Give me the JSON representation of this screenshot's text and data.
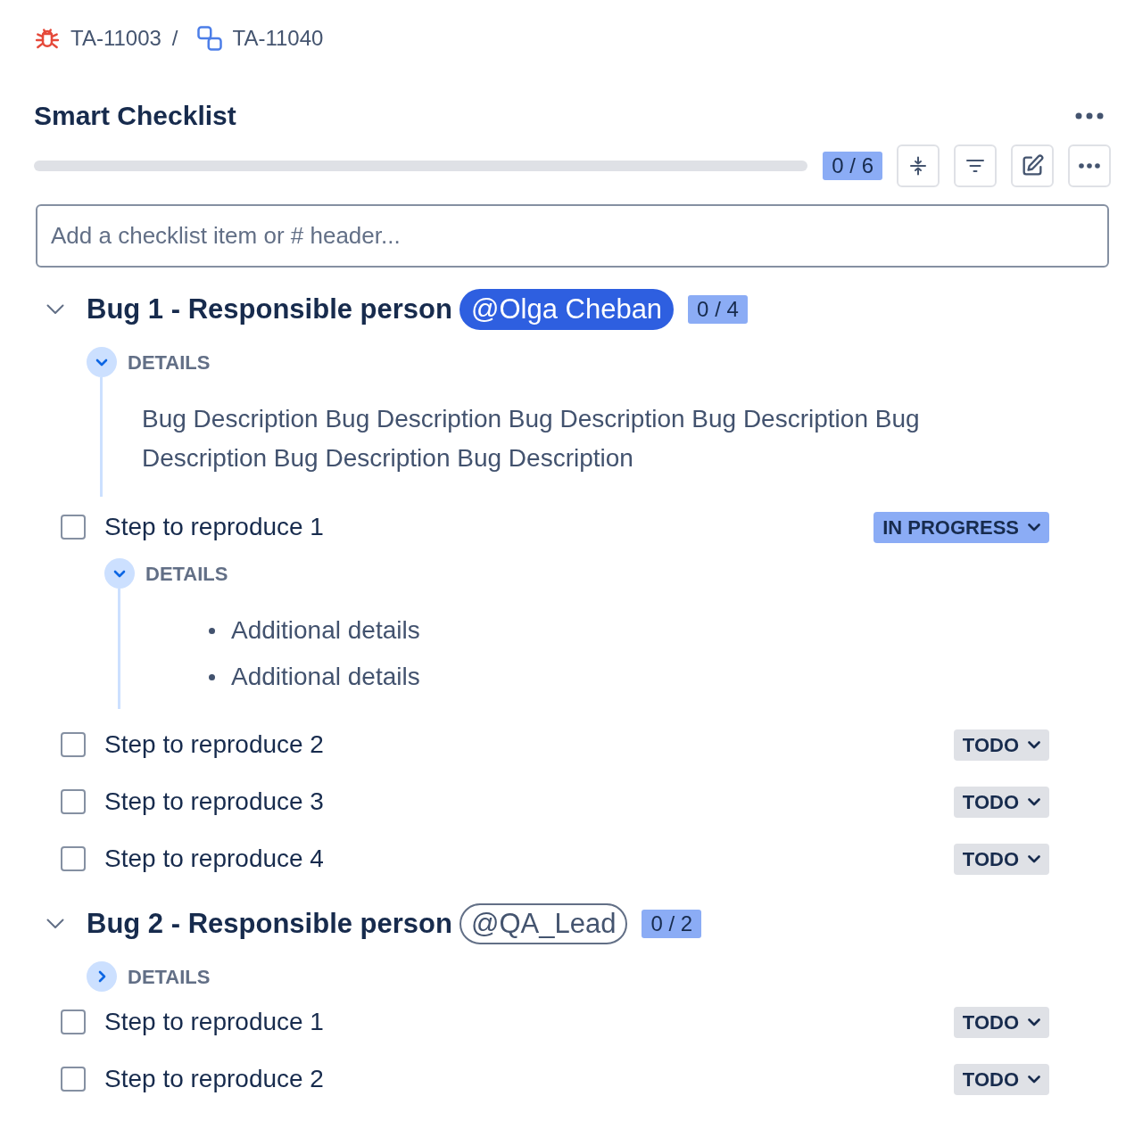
{
  "breadcrumbs": {
    "separator": "/",
    "items": [
      {
        "kind": "bug",
        "label": "TA-11003"
      },
      {
        "kind": "subtask",
        "label": "TA-11040"
      }
    ]
  },
  "title": "Smart Checklist",
  "progress": {
    "level": 0,
    "count": "0 / 6"
  },
  "new_item": {
    "placeholder": "Add a checklist item or # header..."
  },
  "sections": [
    {
      "title": "Bug 1 - Responsible person",
      "mention": {
        "label": "@Olga Cheban",
        "kind": "self"
      },
      "count": "0 / 4",
      "expanded": true,
      "details": {
        "label": "DETAILS",
        "expanded": true,
        "text": "Bug Description Bug Description Bug Description Bug Description Bug Description Bug Description Bug Description"
      },
      "items": [
        {
          "label": "Step to reproduce 1",
          "checked": false,
          "status": {
            "label": "IN PROGRESS",
            "kind": "in_progress"
          },
          "details": {
            "label": "DETAILS",
            "expanded": true,
            "bullets": [
              "Additional details",
              "Additional details"
            ]
          }
        },
        {
          "label": "Step to reproduce 2",
          "checked": false,
          "status": {
            "label": "TODO",
            "kind": "todo"
          }
        },
        {
          "label": "Step to reproduce 3",
          "checked": false,
          "status": {
            "label": "TODO",
            "kind": "todo"
          }
        },
        {
          "label": "Step to reproduce 4",
          "checked": false,
          "status": {
            "label": "TODO",
            "kind": "todo"
          }
        }
      ]
    },
    {
      "title": "Bug 2 - Responsible person",
      "mention": {
        "label": "@QA_Lead",
        "kind": "other"
      },
      "count": "0 / 2",
      "expanded": true,
      "details": {
        "label": "DETAILS",
        "expanded": false
      },
      "items": [
        {
          "label": "Step to reproduce 1",
          "checked": false,
          "status": {
            "label": "TODO",
            "kind": "todo"
          }
        },
        {
          "label": "Step to reproduce 2",
          "checked": false,
          "status": {
            "label": "TODO",
            "kind": "todo"
          }
        }
      ]
    }
  ]
}
